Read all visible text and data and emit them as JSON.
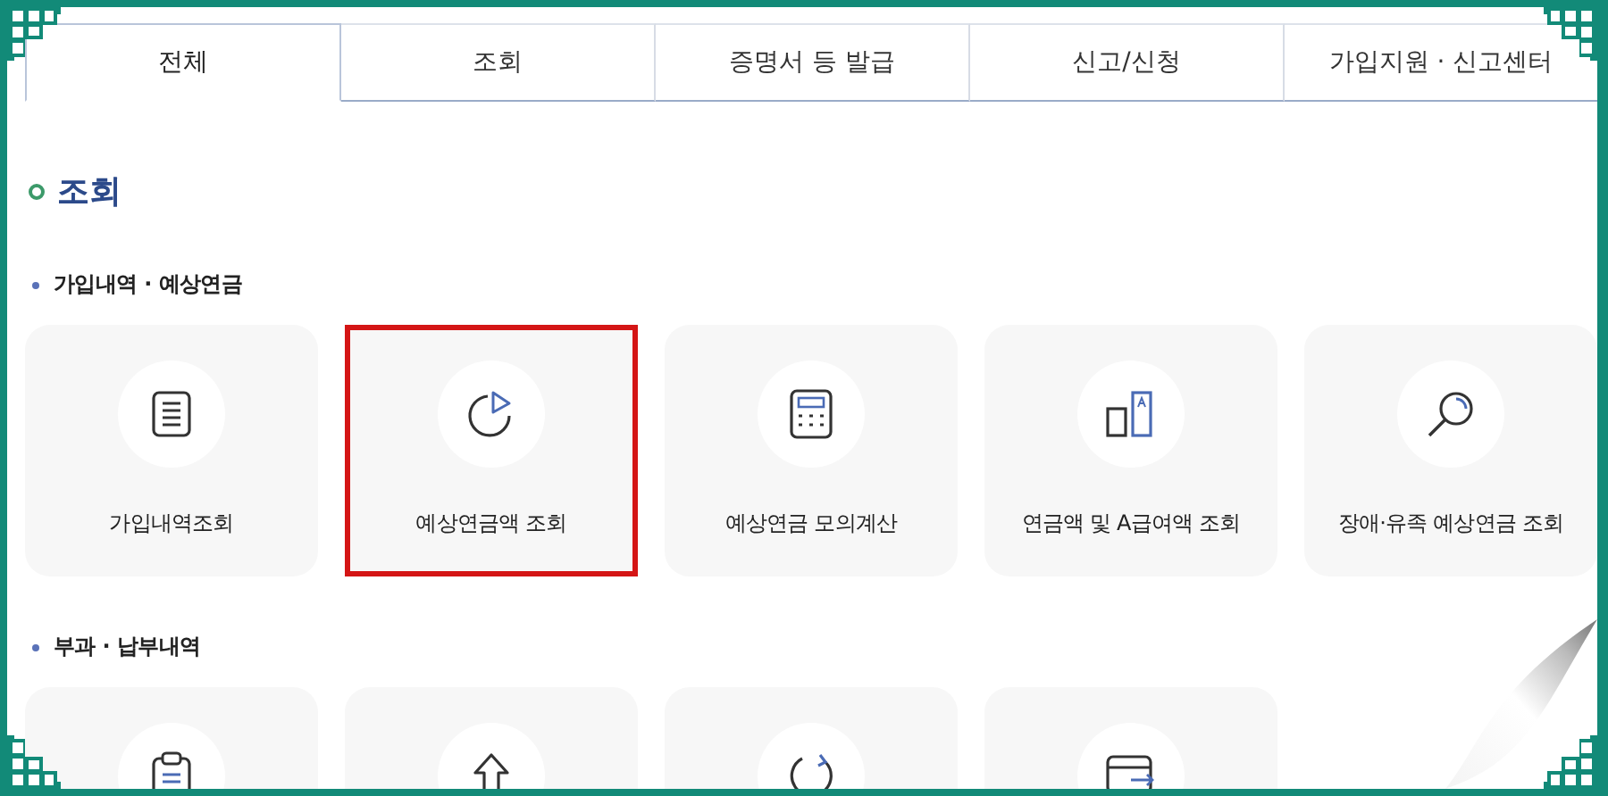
{
  "tabs": [
    {
      "label": "전체",
      "selected": true
    },
    {
      "label": "조회",
      "selected": false
    },
    {
      "label": "증명서 등 발급",
      "selected": false
    },
    {
      "label": "신고/신청",
      "selected": false
    },
    {
      "label": "가입지원 · 신고센터",
      "selected": false
    }
  ],
  "heading": "조회",
  "sections": [
    {
      "title": "가입내역 · 예상연금",
      "items": [
        {
          "kind": "document",
          "label": "가입내역조회",
          "highlighted": false
        },
        {
          "kind": "pie",
          "label": "예상연금액 조회",
          "highlighted": true
        },
        {
          "kind": "calculator",
          "label": "예상연금 모의계산",
          "highlighted": false
        },
        {
          "kind": "compare",
          "label": "연금액 및 A급여액 조회",
          "highlighted": false
        },
        {
          "kind": "search",
          "label": "장애·유족 예상연금 조회",
          "highlighted": false
        }
      ]
    },
    {
      "title": "부과 · 납부내역",
      "items": [
        {
          "kind": "clipboard",
          "highlighted": false
        },
        {
          "kind": "upload",
          "highlighted": false
        },
        {
          "kind": "refresh",
          "highlighted": false
        },
        {
          "kind": "card",
          "highlighted": false
        }
      ]
    }
  ]
}
